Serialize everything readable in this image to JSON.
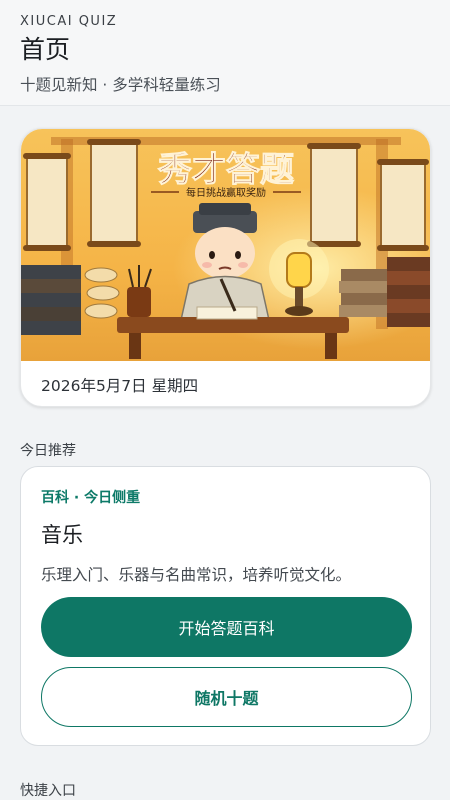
{
  "header": {
    "app_name": "XIUCAI QUIZ",
    "title": "首页",
    "subtitle": "十题见新知 · 多学科轻量练习"
  },
  "hero": {
    "banner_title": "秀才答题",
    "banner_tagline": "每日挑战赢取奖励",
    "date": "2026年5月7日 星期四"
  },
  "today": {
    "section_label": "今日推荐",
    "tag": "百科 · 今日侧重",
    "title": "音乐",
    "description": "乐理入门、乐器与名曲常识，培养听觉文化。",
    "primary_button": "开始答题百科",
    "secondary_button": "随机十题"
  },
  "quick": {
    "section_label": "快捷入口"
  },
  "colors": {
    "accent": "#0e7765",
    "background": "#f1f3f5"
  }
}
